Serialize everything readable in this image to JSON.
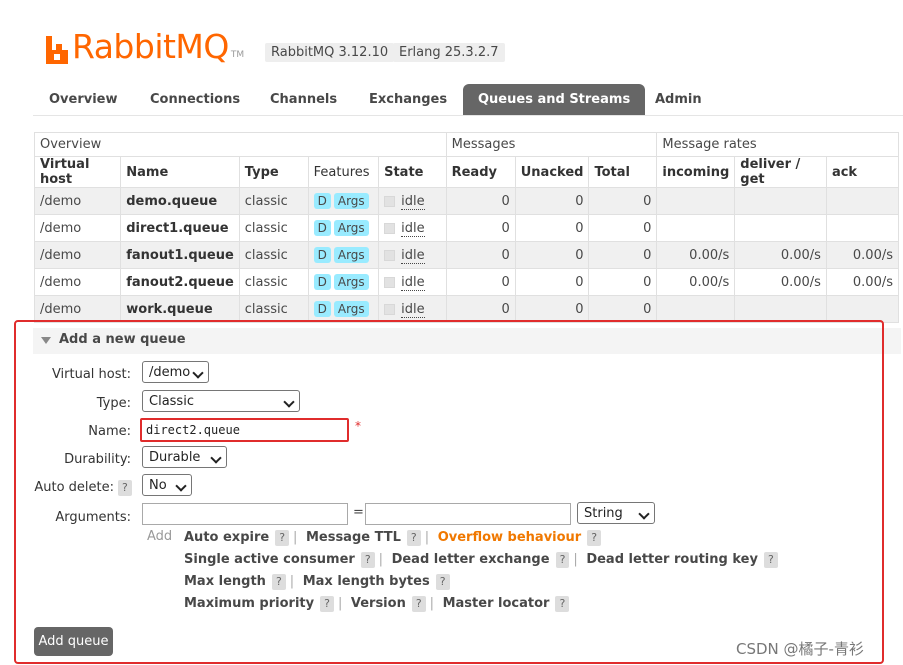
{
  "brand": {
    "logo_text": "RabbitMQ",
    "tm": "TM",
    "version": "RabbitMQ 3.12.10",
    "erlang": "Erlang 25.3.2.7",
    "accent": "#ff6600"
  },
  "nav": {
    "overview": "Overview",
    "connections": "Connections",
    "channels": "Channels",
    "exchanges": "Exchanges",
    "queues": "Queues and Streams",
    "admin": "Admin"
  },
  "table": {
    "groups": {
      "overview": "Overview",
      "messages": "Messages",
      "rates": "Message rates"
    },
    "headers": {
      "vhost": "Virtual host",
      "name": "Name",
      "type": "Type",
      "features": "Features",
      "state": "State",
      "ready": "Ready",
      "unacked": "Unacked",
      "total": "Total",
      "incoming": "incoming",
      "deliver": "deliver / get",
      "ack": "ack"
    },
    "rows": [
      {
        "vhost": "/demo",
        "name": "demo.queue",
        "type": "classic",
        "f1": "D",
        "f2": "Args",
        "state": "idle",
        "ready": "0",
        "unacked": "0",
        "total": "0",
        "incoming": "",
        "deliver": "",
        "ack": ""
      },
      {
        "vhost": "/demo",
        "name": "direct1.queue",
        "type": "classic",
        "f1": "D",
        "f2": "Args",
        "state": "idle",
        "ready": "0",
        "unacked": "0",
        "total": "0",
        "incoming": "",
        "deliver": "",
        "ack": ""
      },
      {
        "vhost": "/demo",
        "name": "fanout1.queue",
        "type": "classic",
        "f1": "D",
        "f2": "Args",
        "state": "idle",
        "ready": "0",
        "unacked": "0",
        "total": "0",
        "incoming": "0.00/s",
        "deliver": "0.00/s",
        "ack": "0.00/s"
      },
      {
        "vhost": "/demo",
        "name": "fanout2.queue",
        "type": "classic",
        "f1": "D",
        "f2": "Args",
        "state": "idle",
        "ready": "0",
        "unacked": "0",
        "total": "0",
        "incoming": "0.00/s",
        "deliver": "0.00/s",
        "ack": "0.00/s"
      },
      {
        "vhost": "/demo",
        "name": "work.queue",
        "type": "classic",
        "f1": "D",
        "f2": "Args",
        "state": "idle",
        "ready": "0",
        "unacked": "0",
        "total": "0",
        "incoming": "",
        "deliver": "",
        "ack": ""
      }
    ]
  },
  "form": {
    "title": "Add a new queue",
    "vhost_label": "Virtual host:",
    "vhost_value": "/demo",
    "type_label": "Type:",
    "type_value": "Classic",
    "name_label": "Name:",
    "name_value": "direct2.queue",
    "required": "*",
    "durability_label": "Durability:",
    "durability_value": "Durable",
    "autodelete_label": "Auto delete:",
    "autodelete_value": "No",
    "help": "?",
    "arguments_label": "Arguments:",
    "equals": "=",
    "arg_type": "String",
    "add_label": "Add",
    "options": {
      "auto_expire": "Auto expire",
      "message_ttl": "Message TTL",
      "overflow": "Overflow behaviour",
      "single_active": "Single active consumer",
      "dlx": "Dead letter exchange",
      "dlrk": "Dead letter routing key",
      "max_length": "Max length",
      "max_length_bytes": "Max length bytes",
      "max_priority": "Maximum priority",
      "version": "Version",
      "master_locator": "Master locator",
      "sep": "|"
    },
    "submit": "Add queue"
  },
  "watermark": "CSDN @橘子-青衫"
}
